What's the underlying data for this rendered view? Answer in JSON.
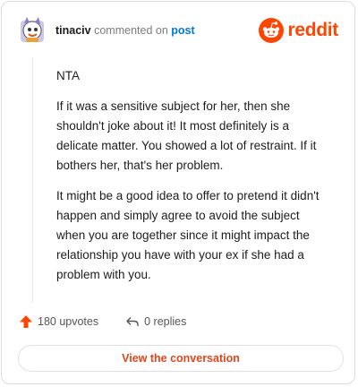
{
  "header": {
    "username": "tinaciv",
    "action_text": "commented on",
    "target_link": "post",
    "brand_name": "reddit"
  },
  "comment": {
    "paragraphs": [
      "NTA",
      "If it was a sensitive subject for her, then she shouldn't joke about it! It most definitely is a delicate matter. You showed a lot of restraint. If it bothers her, that's her problem.",
      "It might be a good idea to offer to pretend it didn't happen and simply agree to avoid the subject when you are together since it might impact the relationship you have with your ex if she had a problem with you."
    ]
  },
  "footer": {
    "upvotes": "180 upvotes",
    "replies": "0 replies",
    "cta_label": "View the conversation"
  },
  "colors": {
    "brand": "#ff4500",
    "link": "#0079d3",
    "cta_text": "#e0451b"
  },
  "icons": {
    "avatar": "avatar-icon",
    "brand": "reddit-logo-icon",
    "upvote": "upvote-arrow-icon",
    "reply": "reply-arrow-icon"
  }
}
